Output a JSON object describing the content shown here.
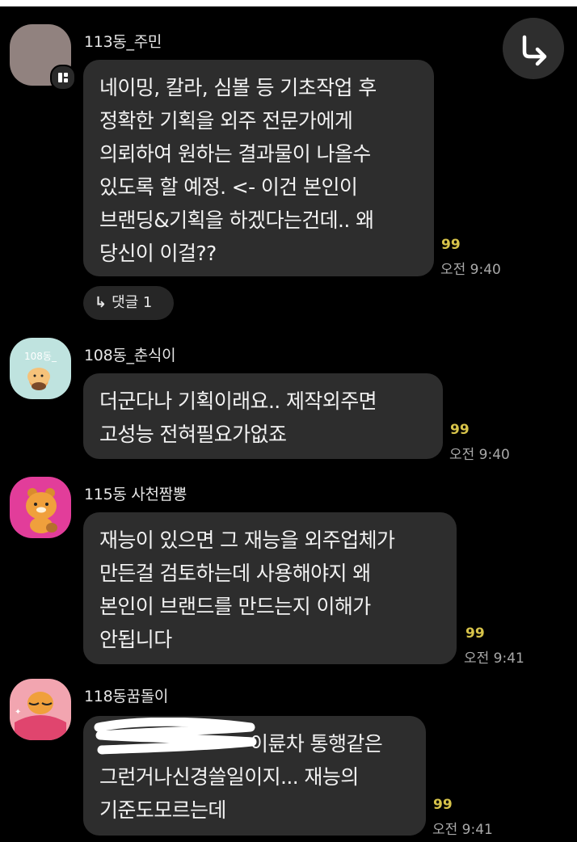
{
  "messages": [
    {
      "sender": "113동_주민",
      "lines": [
        "네이밍, 칼라, 심볼 등 기초작업 후",
        "정확한 기획을 외주 전문가에게",
        "의뢰하여 원하는 결과물이 나올수",
        "있도록 할 예정.  <- 이건 본인이",
        "브랜딩&기획을 하겠다는건데.. 왜",
        "당신이 이걸??"
      ],
      "quote": "99",
      "time": "오전 9:40",
      "reply": {
        "arrow": "↳",
        "label": "댓글 1"
      }
    },
    {
      "sender": "108동_춘식이",
      "avatar_text": "108동_",
      "lines": [
        "더군다나 기획이래요..  제작외주면",
        "고성능 전혀필요가없죠"
      ],
      "quote": "99",
      "time": "오전 9:40"
    },
    {
      "sender": "115동 사천짬뽕",
      "lines": [
        "재능이 있으면 그 재능을 외주업체가",
        "만든걸 검토하는데 사용해야지 왜",
        "본인이 브랜드를 만드는지 이해가",
        "안됩니다"
      ],
      "quote": "99",
      "time": "오전 9:41"
    },
    {
      "sender": "118동꿈돌이",
      "lines": [
        "이륜차 통행같은",
        "그런거나신경쓸일이지... 재능의",
        "기준도모르는데"
      ],
      "quote": "99",
      "time": "오전 9:41"
    }
  ],
  "icons": {
    "forward": "forward-arrow-icon",
    "badge": "book-badge-icon"
  },
  "colors": {
    "background": "#000000",
    "bubble": "#2d2d2d",
    "quote": "#d7c34a",
    "time": "#a9a9a9"
  }
}
